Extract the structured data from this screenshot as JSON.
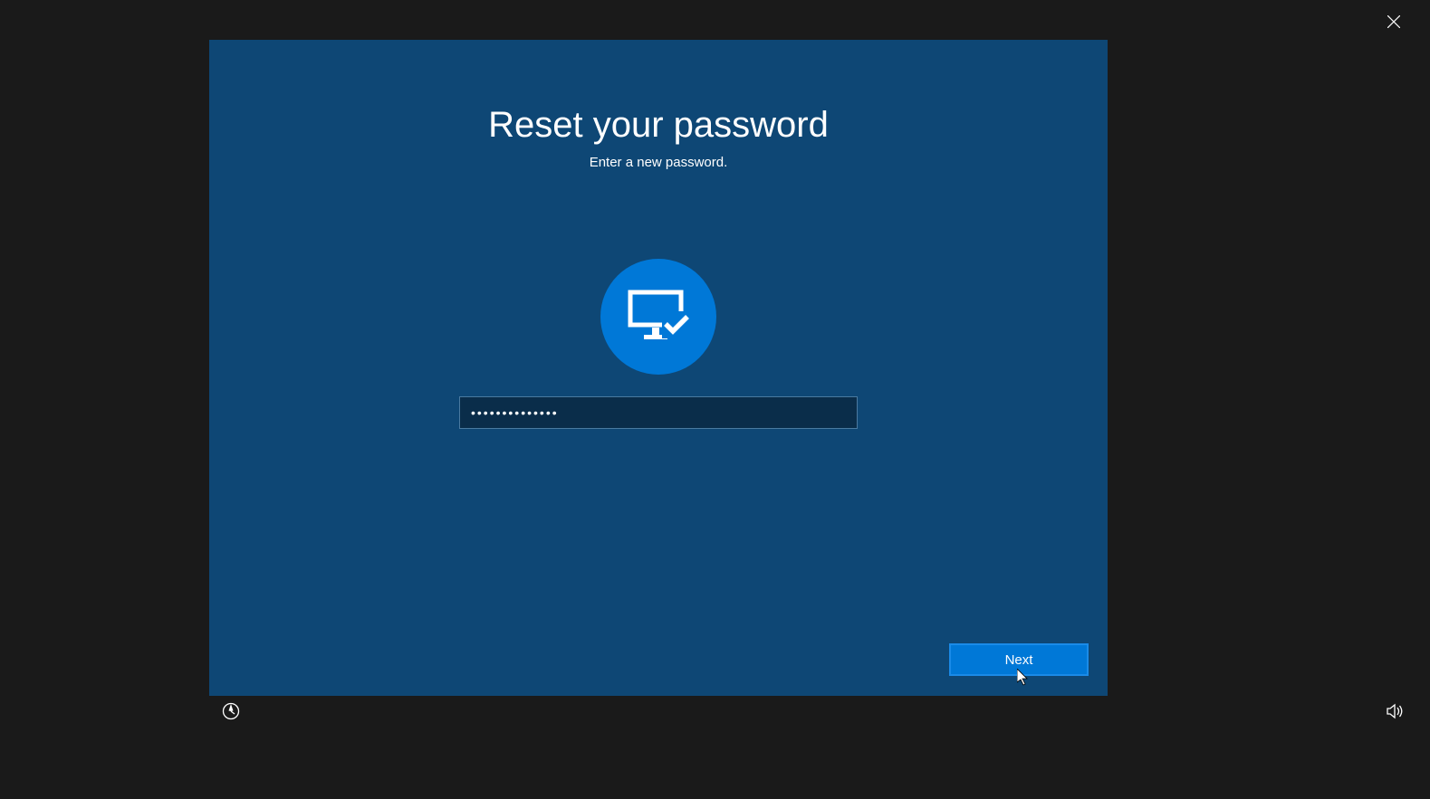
{
  "header": {
    "title": "Reset your password",
    "subtitle": "Enter a new password."
  },
  "form": {
    "password_value": "••••••••••••••",
    "next_button_label": "Next"
  },
  "icons": {
    "close": "close-icon",
    "avatar": "monitor-check-icon",
    "ease_of_access": "ease-of-access-icon",
    "volume": "volume-icon"
  }
}
